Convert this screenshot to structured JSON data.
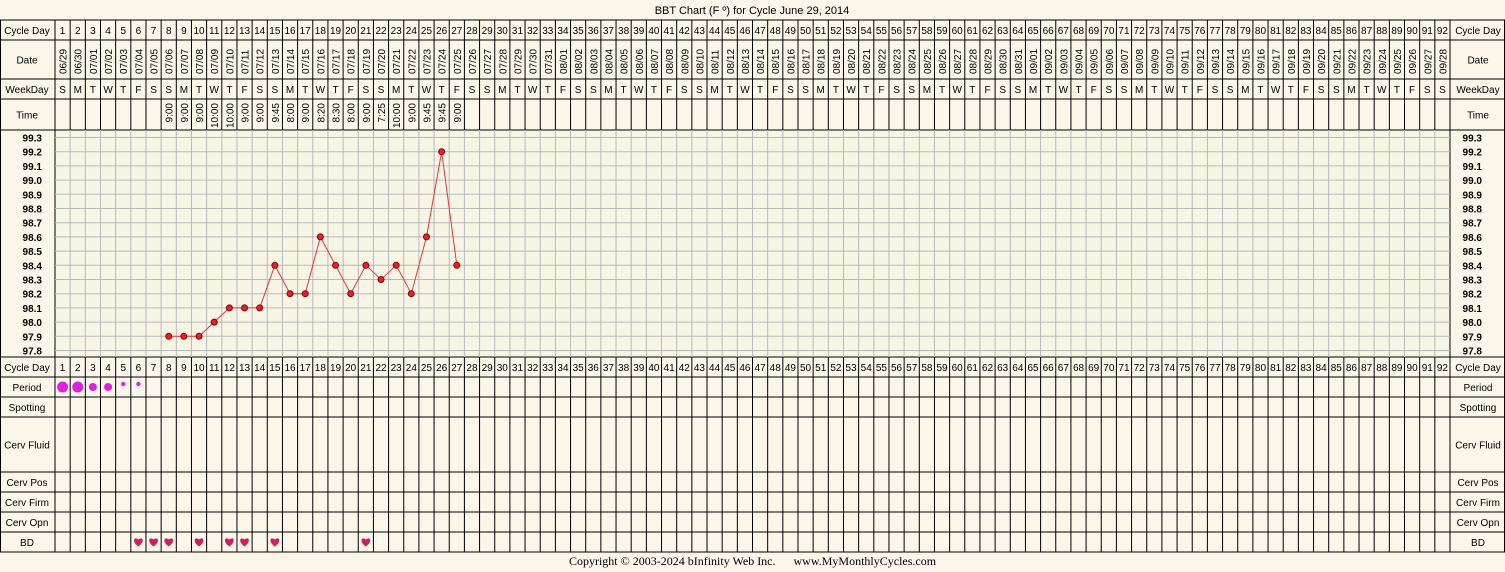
{
  "title": "BBT Chart (F º) for Cycle June 29, 2014",
  "row_labels": {
    "cycle_day": "Cycle Day",
    "date": "Date",
    "weekday": "WeekDay",
    "time": "Time",
    "period": "Period",
    "spotting": "Spotting",
    "cerv_fluid": "Cerv Fluid",
    "cerv_pos": "Cerv Pos",
    "cerv_firm": "Cerv Firm",
    "cerv_opn": "Cerv Opn",
    "bd": "BD"
  },
  "footer": {
    "copyright": "Copyright © 2003-2024 bInfinity Web Inc.",
    "site": "www.MyMonthlyCycles.com"
  },
  "colors": {
    "line": "#e8353a",
    "point_fill": "#e8202a",
    "period": "#dd22dd",
    "heart": "#d81b60",
    "grid": "#b9b9b9",
    "plot_bg": "#f7f5e6"
  },
  "days": 92,
  "start_date": "06/29",
  "weekday_cycle": [
    "S",
    "M",
    "T",
    "W",
    "T",
    "F",
    "S"
  ],
  "times": [
    "",
    "",
    "",
    "",
    "",
    "",
    "",
    "9:00",
    "9:00",
    "9:00",
    "10:00",
    "10:00",
    "9:00",
    "9:00",
    "9:45",
    "8:00",
    "9:00",
    "8:20",
    "8:30",
    "8:00",
    "9:00",
    "7:25",
    "10:00",
    "9:00",
    "9:45",
    "9:45",
    "9:00"
  ],
  "chart_data": {
    "type": "line",
    "title": "BBT Chart (F º) for Cycle June 29, 2014",
    "xlabel": "Cycle Day",
    "ylabel": "",
    "ylim": [
      97.8,
      99.3
    ],
    "y_ticks": [
      99.3,
      99.2,
      99.1,
      99.0,
      98.9,
      98.8,
      98.7,
      98.6,
      98.5,
      98.4,
      98.3,
      98.2,
      98.1,
      98.0,
      97.9,
      97.8
    ],
    "x": [
      8,
      9,
      10,
      11,
      12,
      13,
      14,
      15,
      16,
      17,
      18,
      19,
      20,
      21,
      22,
      23,
      24,
      25,
      26,
      27
    ],
    "y": [
      97.9,
      97.9,
      97.9,
      98.0,
      98.1,
      98.1,
      98.1,
      98.4,
      98.2,
      98.2,
      98.6,
      98.4,
      98.2,
      98.4,
      98.3,
      98.4,
      98.2,
      98.6,
      99.2,
      98.4
    ],
    "period": [
      {
        "day": 1,
        "level": "heavy"
      },
      {
        "day": 2,
        "level": "heavy"
      },
      {
        "day": 3,
        "level": "medium"
      },
      {
        "day": 4,
        "level": "medium"
      },
      {
        "day": 5,
        "level": "light"
      },
      {
        "day": 6,
        "level": "light"
      }
    ],
    "bd_days": [
      6,
      7,
      8,
      10,
      12,
      13,
      15,
      21
    ],
    "grid": true
  }
}
